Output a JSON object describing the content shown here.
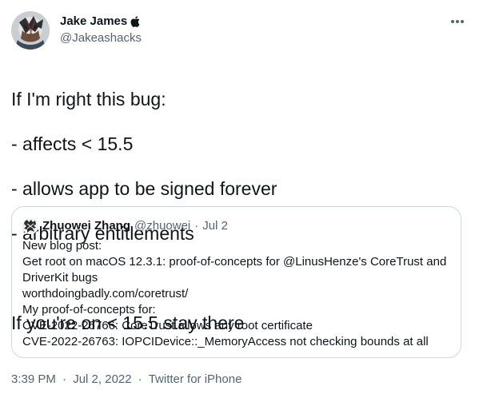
{
  "author": {
    "display_name": "Jake James",
    "handle": "@Jakeashacks",
    "verified_badge_icon": "apple-icon",
    "avatar_icon": "avatar"
  },
  "more_icon": "more-horizontal-icon",
  "tweet": {
    "lines": [
      "If I'm right this bug:",
      "- affects < 15.5",
      "- allows app to be signed forever",
      "- arbitrary entitlements",
      "",
      "If you're on < 15.5 stay there"
    ]
  },
  "quote": {
    "display_name": "Zhuowei Zhang",
    "handle": "@zhuowei",
    "separator": "·",
    "date": "Jul 2",
    "body_lines": [
      "New blog post:",
      "Get root on macOS 12.3.1: proof-of-concepts for @LinusHenze's CoreTrust and",
      "DriverKit bugs",
      "worthdoingbadly.com/coretrust/",
      "My proof-of-concepts for:",
      "CVE-2022-26766: CoreTrust allows any root certificate",
      "CVE-2022-26763: IOPCIDevice::_MemoryAccess not checking bounds at all"
    ]
  },
  "meta": {
    "time": "3:39 PM",
    "separator": "·",
    "date": "Jul 2, 2022",
    "source": "Twitter for iPhone"
  },
  "colors": {
    "text": "#0f1419",
    "secondary": "#536471",
    "border": "#cfd9de"
  }
}
